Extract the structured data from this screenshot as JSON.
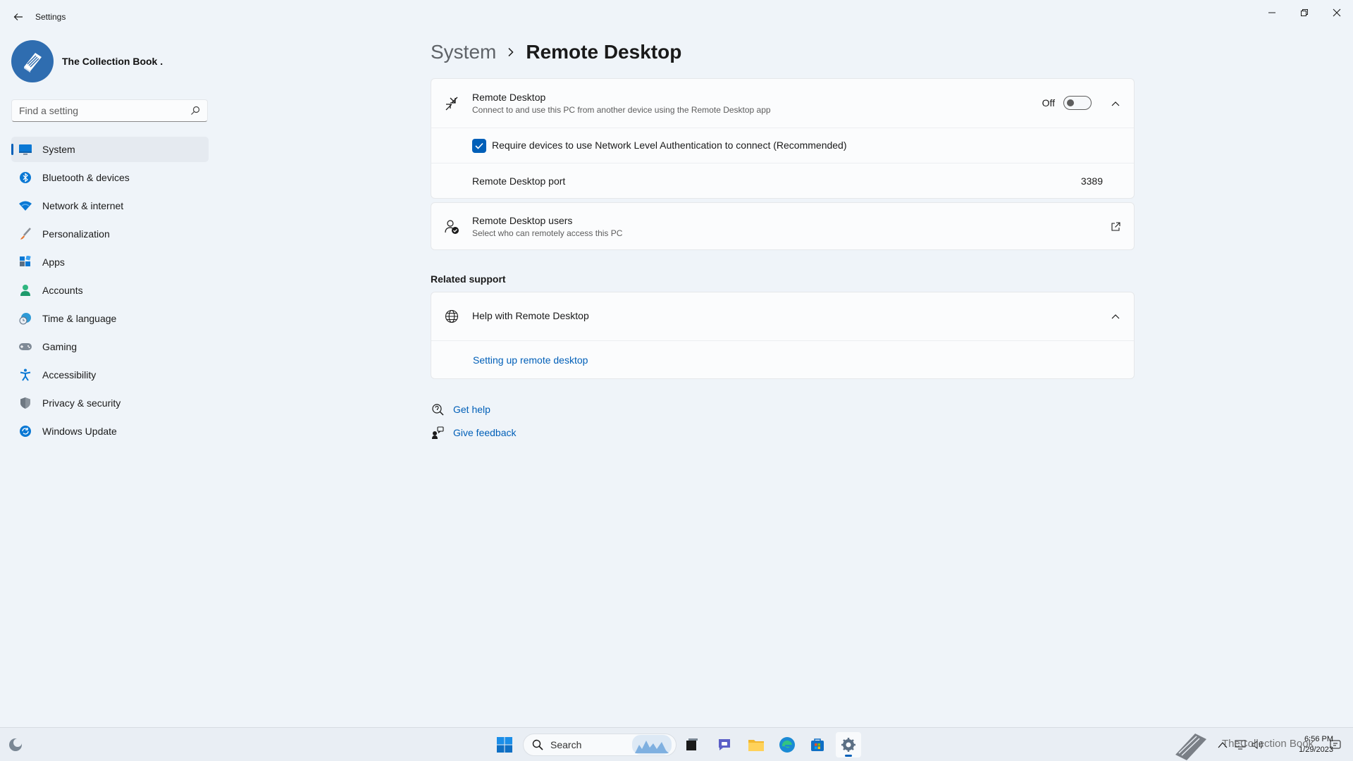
{
  "window": {
    "title": "Settings"
  },
  "profile": {
    "name": "The Collection Book ."
  },
  "search": {
    "placeholder": "Find a setting"
  },
  "sidebar": {
    "items": [
      {
        "label": "System",
        "icon": "monitor-icon",
        "active": true
      },
      {
        "label": "Bluetooth & devices",
        "icon": "bluetooth-icon"
      },
      {
        "label": "Network & internet",
        "icon": "wifi-icon"
      },
      {
        "label": "Personalization",
        "icon": "brush-icon"
      },
      {
        "label": "Apps",
        "icon": "apps-icon"
      },
      {
        "label": "Accounts",
        "icon": "person-icon"
      },
      {
        "label": "Time & language",
        "icon": "clock-globe-icon"
      },
      {
        "label": "Gaming",
        "icon": "gamepad-icon"
      },
      {
        "label": "Accessibility",
        "icon": "accessibility-icon"
      },
      {
        "label": "Privacy & security",
        "icon": "shield-icon"
      },
      {
        "label": "Windows Update",
        "icon": "update-icon"
      }
    ]
  },
  "breadcrumb": {
    "parent": "System",
    "current": "Remote Desktop"
  },
  "remote_desktop": {
    "title": "Remote Desktop",
    "subtitle": "Connect to and use this PC from another device using the Remote Desktop app",
    "toggle_state": "Off",
    "nla_label": "Require devices to use Network Level Authentication to connect (Recommended)",
    "nla_checked": true,
    "port_label": "Remote Desktop port",
    "port_value": "3389"
  },
  "users": {
    "title": "Remote Desktop users",
    "subtitle": "Select who can remotely access this PC"
  },
  "related": {
    "header": "Related support",
    "help_title": "Help with Remote Desktop",
    "link": "Setting up remote desktop"
  },
  "footer_links": {
    "get_help": "Get help",
    "give_feedback": "Give feedback"
  },
  "taskbar": {
    "search_label": "Search",
    "time": "6:56 PM",
    "date": "1/29/2023",
    "watermark": "TheCollection Book"
  },
  "colors": {
    "accent": "#005fb8",
    "background": "#eff4f9",
    "card": "#fbfcfd"
  }
}
